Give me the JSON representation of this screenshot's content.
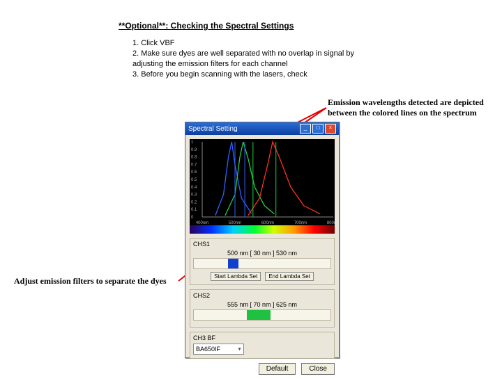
{
  "title": "**Optional**: Checking the Spectral Settings",
  "instructions": [
    "1. Click VBF",
    "2. Make sure dyes are well separated with no overlap in signal by adjusting the emission filters for each channel",
    "3. Before you begin scanning with the lasers, check"
  ],
  "annot_top_l1": "Emission wavelengths detected are depicted",
  "annot_top_l2": "between the colored lines on the spectrum",
  "annot_left": "Adjust emission filters to separate the dyes",
  "dialog": {
    "title": "Spectral Setting",
    "min_btn": "_",
    "max_btn": "□",
    "close_btn": "×",
    "yticks": [
      "1",
      "0.9",
      "0.8",
      "0.7",
      "0.6",
      "0.5",
      "0.4",
      "0.3",
      "0.2",
      "0.1",
      "0"
    ],
    "xticks": [
      "400nm",
      "500nm",
      "600nm",
      "700nm",
      "800nm"
    ],
    "chs1_label": "CHS1",
    "chs1_readout": "500 nm  [ 30 nm ]  530 nm",
    "chs1_start": "Start Lambda Set",
    "chs1_end": "End Lambda Set",
    "chs2_label": "CHS2",
    "chs2_readout": "555 nm  [ 70 nm ]  625 nm",
    "ch3_label": "CH3 BF",
    "ch3_value": "BA650IF",
    "default_btn": "Default",
    "close2_btn": "Close"
  },
  "chart_data": {
    "type": "line",
    "xlabel": "",
    "ylabel": "",
    "xlim": [
      400,
      800
    ],
    "ylim": [
      0,
      1
    ],
    "series": [
      {
        "name": "blue-dye",
        "color": "#3060ff",
        "x": [
          440,
          465,
          480,
          490,
          500,
          520,
          550
        ],
        "y": [
          0.02,
          0.3,
          0.8,
          1.0,
          0.7,
          0.25,
          0.05
        ]
      },
      {
        "name": "green-dye",
        "color": "#20d040",
        "x": [
          470,
          500,
          515,
          525,
          540,
          560,
          590,
          620
        ],
        "y": [
          0.02,
          0.3,
          0.8,
          1.0,
          0.78,
          0.4,
          0.15,
          0.04
        ]
      },
      {
        "name": "red-dye",
        "color": "#ff3020",
        "x": [
          540,
          575,
          600,
          615,
          635,
          670,
          710,
          760
        ],
        "y": [
          0.02,
          0.25,
          0.7,
          1.0,
          0.8,
          0.4,
          0.15,
          0.04
        ]
      }
    ],
    "guides": [
      {
        "color": "#3060ff",
        "x": 500
      },
      {
        "color": "#3060ff",
        "x": 530
      },
      {
        "color": "#20d040",
        "x": 555
      },
      {
        "color": "#20d040",
        "x": 625
      }
    ]
  }
}
